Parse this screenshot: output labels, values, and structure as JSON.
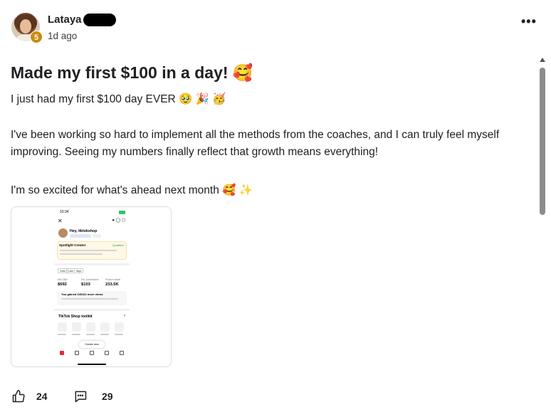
{
  "post": {
    "author": "Lataya",
    "level": "5",
    "time": "1d ago",
    "more_icon": "more-horizontal-icon",
    "title": "Made my first $100 in a day!",
    "title_emoji": "🥰",
    "paragraphs": [
      "I just had my first $100 day EVER 🥹 🎉 🥳",
      "I've been working so hard to implement all the methods from the coaches, and I can truly feel myself improving. Seeing my numbers finally reflect that growth means everything!",
      "I'm so excited for what's ahead next month 🥰 ✨"
    ],
    "attachment": {
      "status_time": "10:34",
      "greeting": "Hey, tiktokshop",
      "card_title": "Spotlight Creator",
      "card_status": "Qualified",
      "tabs": [
        "Data",
        "Last 7 days"
      ],
      "stats": [
        {
          "label": "Net GMV",
          "value": "$692"
        },
        {
          "label": "Est. commission",
          "value": "$103"
        },
        {
          "label": "Product views",
          "value": "233.5K"
        }
      ],
      "gain_text": "You gained 340162 more views",
      "toolkit_title": "TikTok Shop toolkit",
      "create_label": "Create new"
    },
    "likes": "24",
    "comments": "29",
    "like_icon": "thumbs-up-icon",
    "comment_icon": "comment-icon",
    "accent_color": "#c98a0b"
  }
}
